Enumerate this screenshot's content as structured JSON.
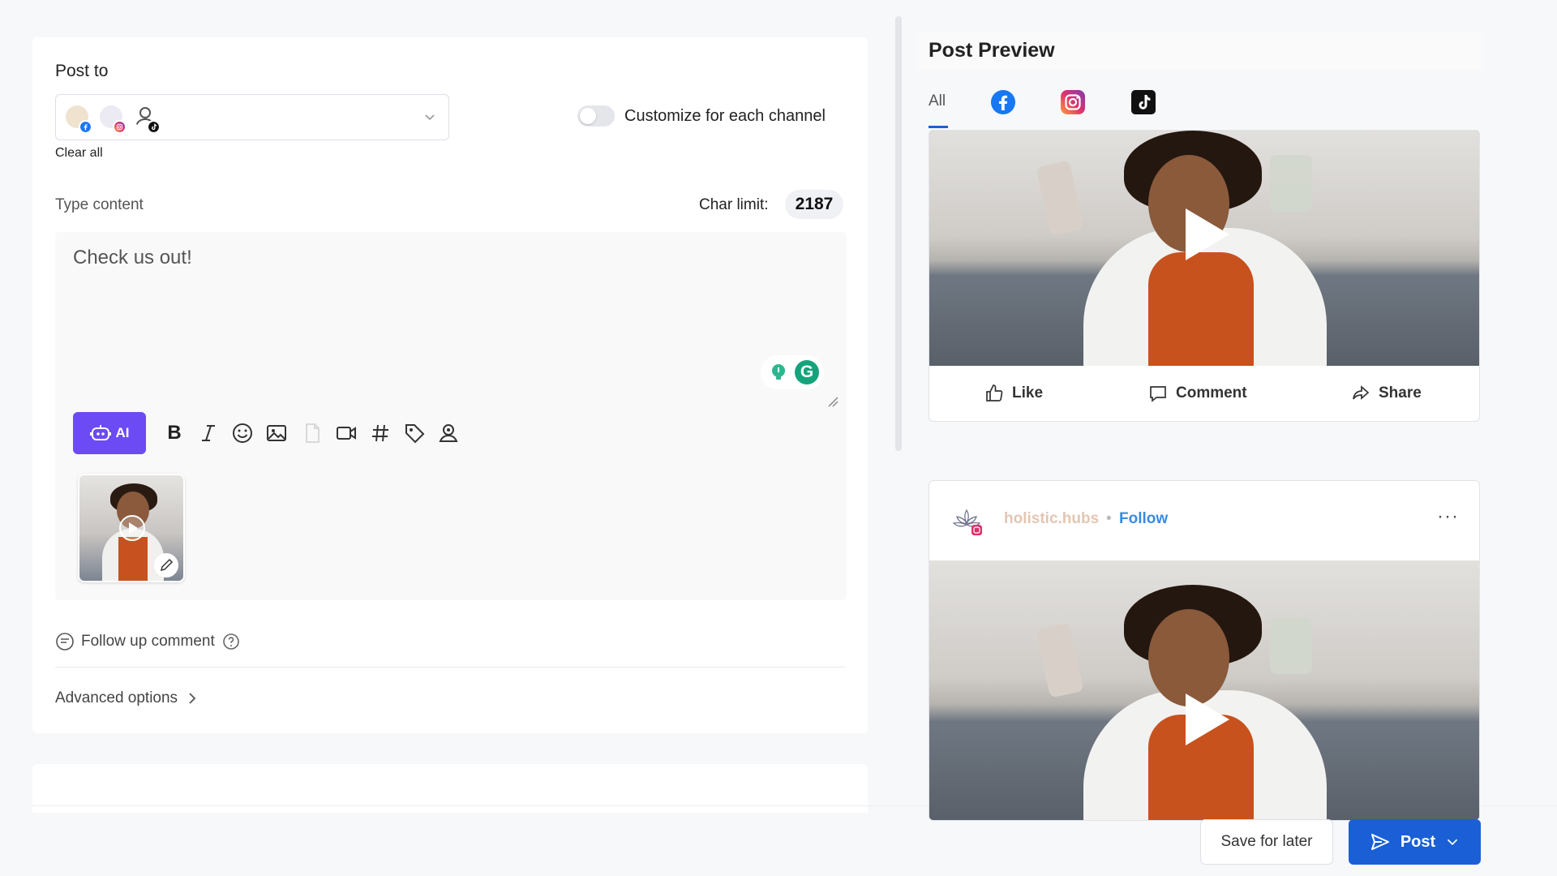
{
  "editor": {
    "post_to_label": "Post to",
    "clear_all_label": "Clear all",
    "customize_label": "Customize for each channel",
    "customize_enabled": false,
    "type_content_label": "Type content",
    "char_limit_label": "Char limit:",
    "char_limit_value": "2187",
    "content_text": "Check us out!",
    "ai_button_label": "AI",
    "follow_up_label": "Follow up comment",
    "advanced_options_label": "Advanced options",
    "selected_channels": [
      {
        "network": "facebook-icon"
      },
      {
        "network": "instagram-icon"
      },
      {
        "network": "tiktok-icon"
      }
    ]
  },
  "preview": {
    "title": "Post Preview",
    "tabs": [
      {
        "label": "All",
        "active": true
      },
      {
        "icon": "facebook-icon"
      },
      {
        "icon": "instagram-icon"
      },
      {
        "icon": "tiktok-icon"
      }
    ],
    "facebook_actions": {
      "like": "Like",
      "comment": "Comment",
      "share": "Share"
    },
    "instagram": {
      "username": "holistic.hubs",
      "separator": "•",
      "follow_label": "Follow",
      "more": "···"
    }
  },
  "footer": {
    "save_later_label": "Save for later",
    "post_label": "Post"
  },
  "colors": {
    "primary": "#1a5fd6",
    "ai_purple": "#6c4bf4",
    "grammarly_green": "#15a37b",
    "instagram_follow": "#3a8be0",
    "facebook_blue": "#1877f2"
  }
}
